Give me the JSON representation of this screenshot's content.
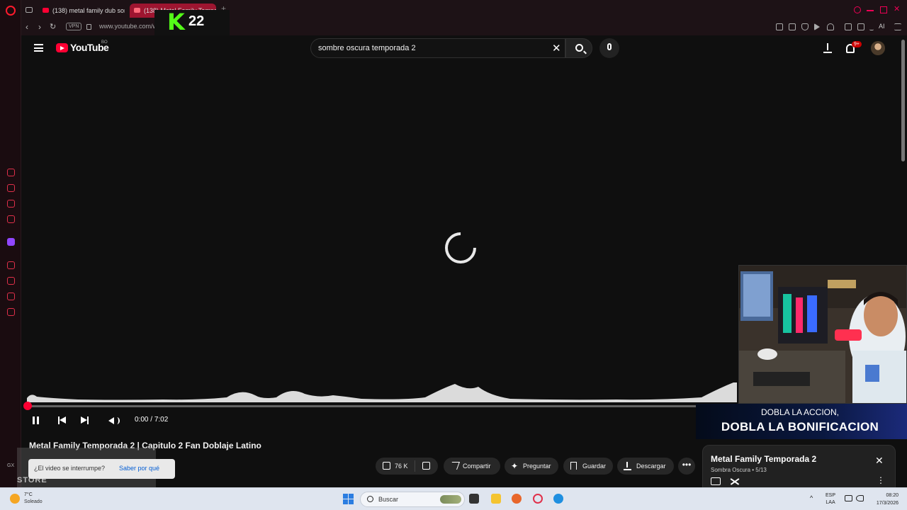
{
  "browser": {
    "tabs": [
      {
        "title": "(138) metal family dub sor",
        "active": false
      },
      {
        "title": "(138) Metal Family Tempor",
        "active": true
      }
    ],
    "new_tab_glyph": "+",
    "vpn_label": "VPN",
    "url": "www.youtube.com/wat",
    "ai_label": "AI",
    "accent": "#9e1530"
  },
  "overlay_k22": {
    "k": "K",
    "number": "22",
    "color": "#53fc18"
  },
  "youtube": {
    "logo_text": "YouTube",
    "country_code": "BO",
    "search": {
      "query": "sombre oscura temporada 2",
      "clear_glyph": "✕"
    },
    "notifications_badge": "9+"
  },
  "player": {
    "state": "loading",
    "current_time": "0:00",
    "duration": "7:02",
    "time_separator": " / ",
    "progress_fraction": 0.0,
    "accent": "#ff0033"
  },
  "webcam_promo": {
    "line1": "DOBLA LA ACCION,",
    "line2": "DOBLA LA BONIFICACION"
  },
  "video": {
    "title": "Metal Family Temporada 2 | Capitulo 2 Fan Doblaje Latino",
    "likes": "76 K",
    "actions": {
      "share": "Compartir",
      "ask": "Preguntar",
      "save": "Guardar",
      "download": "Descargar"
    },
    "more_glyph": "•••"
  },
  "toast": {
    "question": "¿El video se interrumpe?",
    "link": "Saber por qué"
  },
  "store_overlay": {
    "label": "STORE",
    "gx": "GX"
  },
  "playlist": {
    "title": "Metal Family Temporada 2",
    "subtitle": "Sombra Oscura • 5/13",
    "close_glyph": "✕",
    "more_glyph": "⋮"
  },
  "taskbar": {
    "weather_temp": "7°C",
    "weather_condition": "Soleado",
    "search_label": "Buscar",
    "language_line1": "ESP",
    "language_line2": "LAA",
    "time": "08:20",
    "date": "17/3/2026",
    "tray_caret": "^"
  }
}
